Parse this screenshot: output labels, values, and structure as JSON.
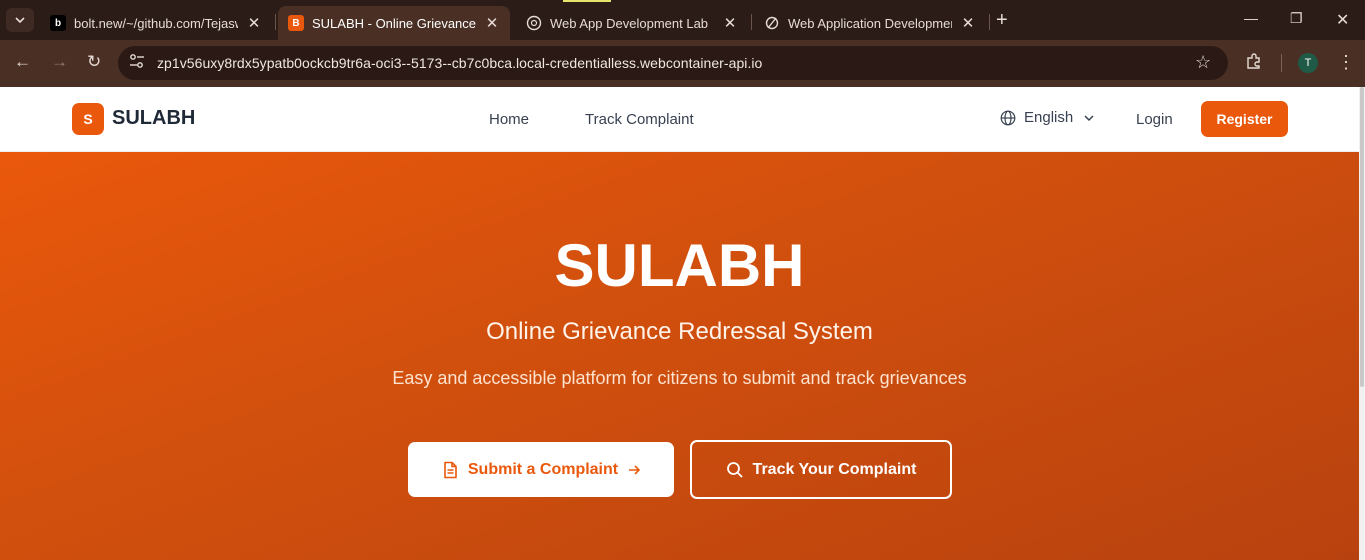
{
  "browser": {
    "tabs": [
      {
        "title": "bolt.new/~/github.com/Tejaswi",
        "favicon": "bolt-icon",
        "active": false
      },
      {
        "title": "SULABH - Online Grievance Red",
        "favicon": "sulabh-icon",
        "active": true
      },
      {
        "title": "Web App Development Lab",
        "favicon": "openai-icon",
        "active": false
      },
      {
        "title": "Web Application Development",
        "favicon": "perplexity-icon",
        "active": false
      }
    ],
    "url": "zp1v56uxy8rdx5ypatb0ockcb9tr6a-oci3--5173--cb7c0bca.local-credentialless.webcontainer-api.io",
    "profile_initial": "T",
    "favicon_letters": {
      "bolt": "b",
      "sulabh": "B"
    }
  },
  "header": {
    "logo_letter": "S",
    "brand": "SULABH",
    "nav": {
      "home": "Home",
      "track": "Track Complaint"
    },
    "language": "English",
    "login": "Login",
    "register": "Register"
  },
  "hero": {
    "title": "SULABH",
    "subtitle": "Online Grievance Redressal System",
    "description": "Easy and accessible platform for citizens to submit and track grievances",
    "submit_button": "Submit a Complaint",
    "track_button": "Track Your Complaint"
  },
  "colors": {
    "accent": "#ea580c",
    "chrome_dark": "#2b1c17",
    "chrome_toolbar": "#4a2f25"
  }
}
